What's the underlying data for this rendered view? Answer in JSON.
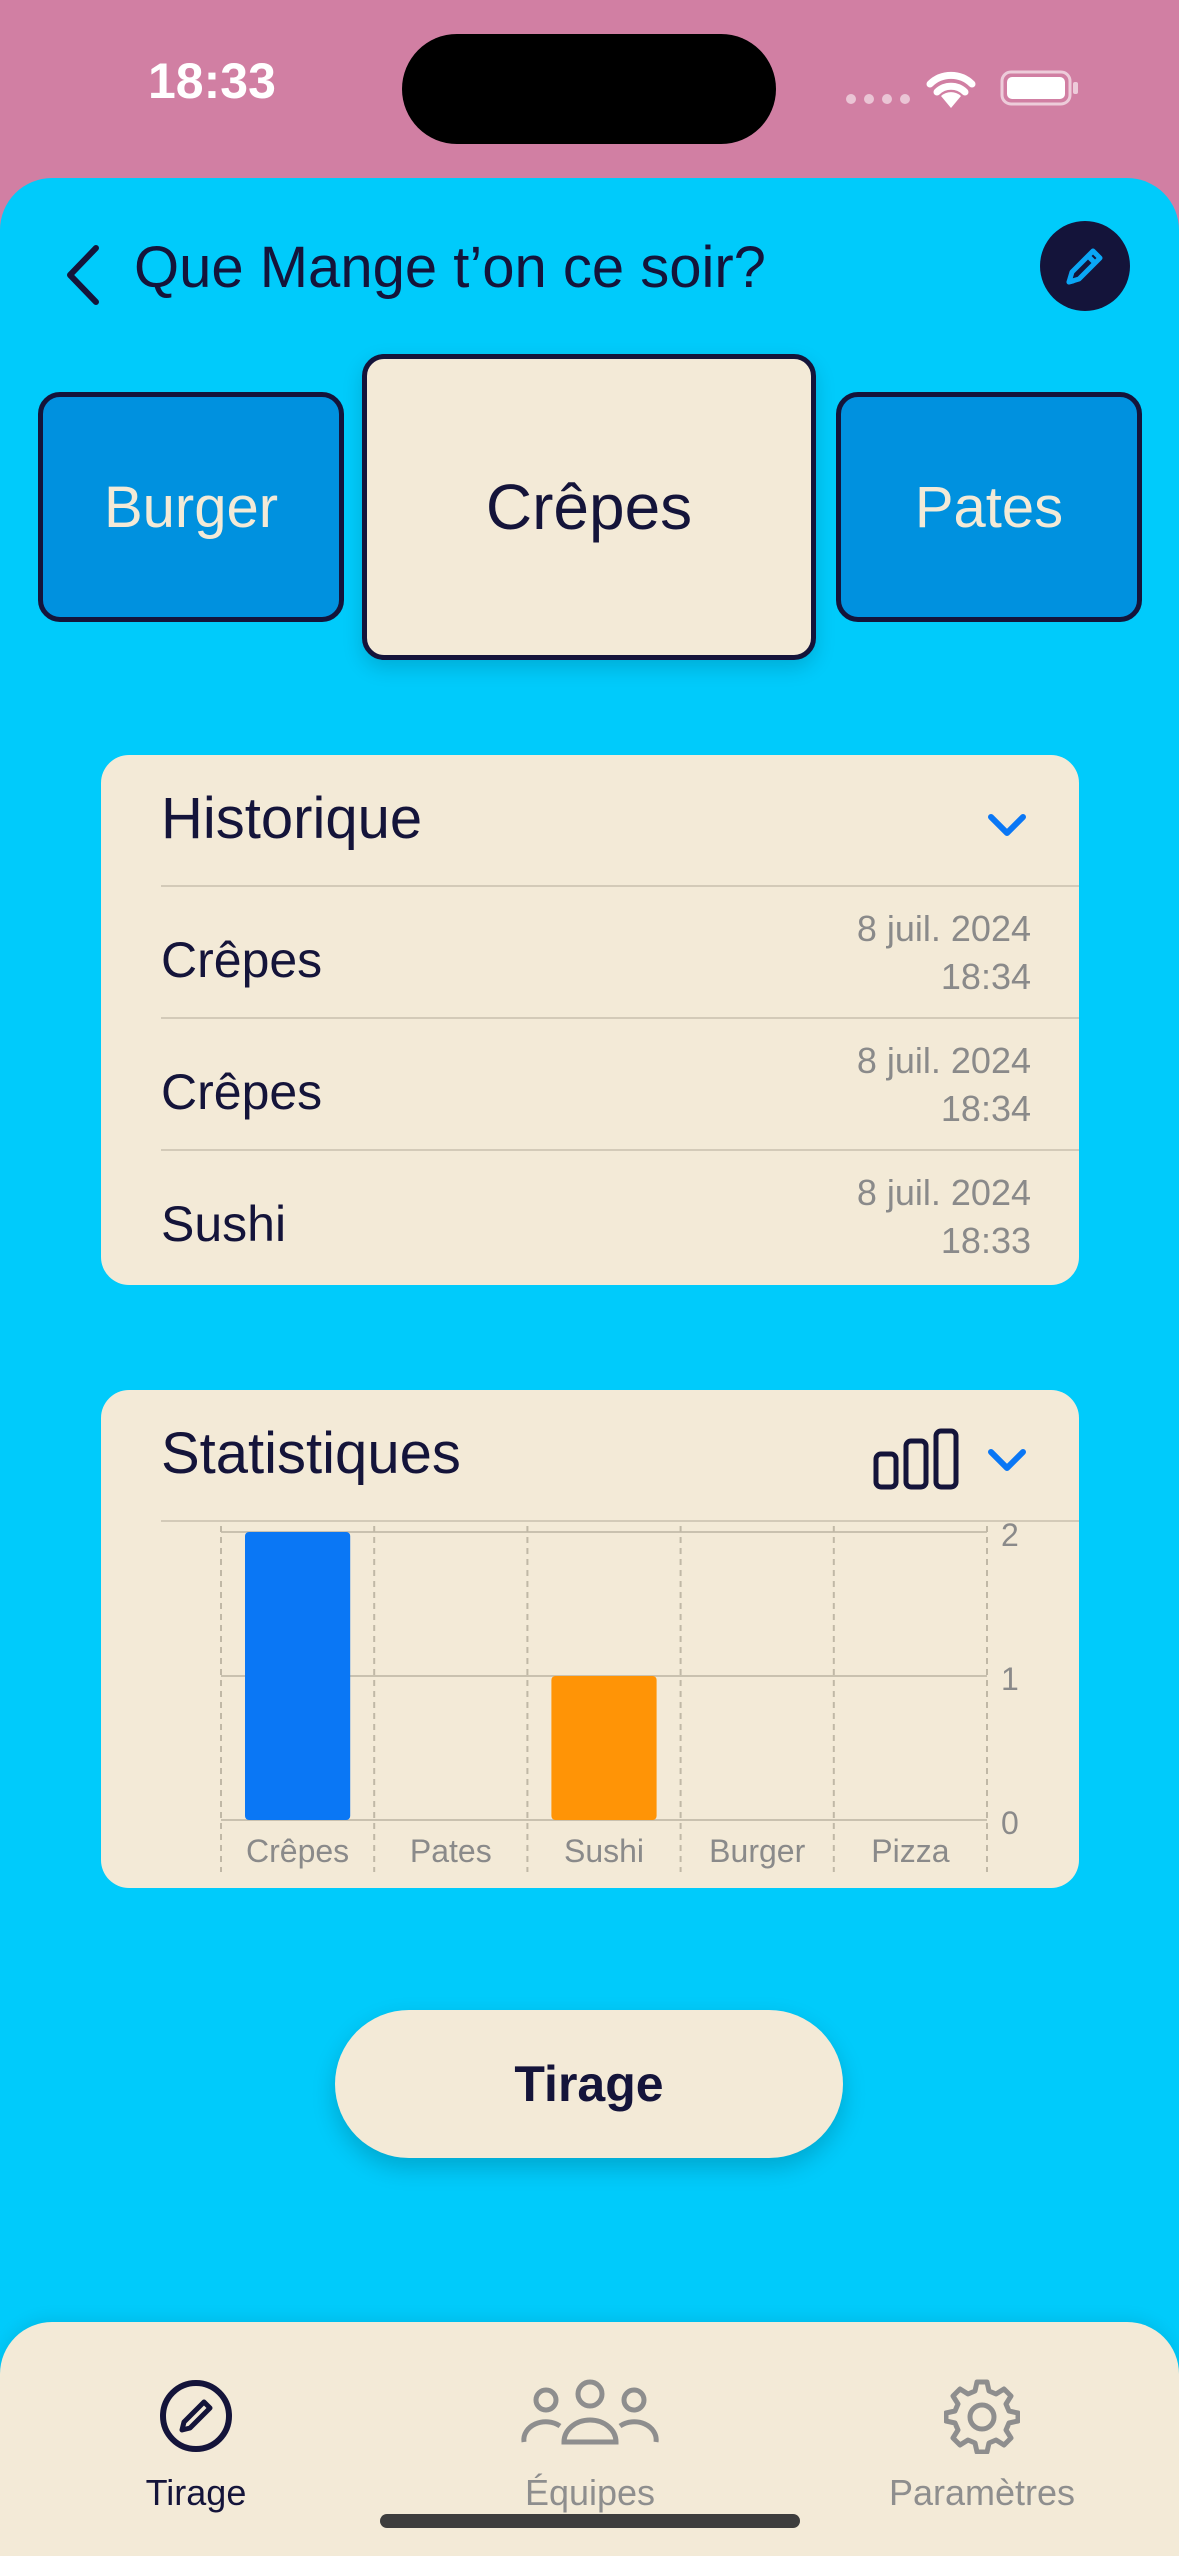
{
  "status_bar": {
    "time": "18:33"
  },
  "header": {
    "title": "Que Mange t’on ce soir?"
  },
  "carousel": {
    "left": "Burger",
    "center": "Crêpes",
    "right": "Pates"
  },
  "history": {
    "title": "Historique",
    "rows": [
      {
        "name": "Crêpes",
        "date": "8 juil. 2024",
        "time": "18:34"
      },
      {
        "name": "Crêpes",
        "date": "8 juil. 2024",
        "time": "18:34"
      },
      {
        "name": "Sushi",
        "date": "8 juil. 2024",
        "time": "18:33"
      }
    ]
  },
  "stats": {
    "title": "Statistiques"
  },
  "chart_data": {
    "type": "bar",
    "categories": [
      "Crêpes",
      "Pates",
      "Sushi",
      "Burger",
      "Pizza"
    ],
    "values": [
      2,
      0,
      1,
      0,
      0
    ],
    "colors": [
      "#0a77f5",
      "#0a77f5",
      "#ff9406",
      "#0a77f5",
      "#0a77f5"
    ],
    "ylim": [
      0,
      2
    ],
    "yticks": [
      "0",
      "1",
      "2"
    ],
    "grid": true
  },
  "draw_button": {
    "label": "Tirage"
  },
  "tabbar": {
    "items": [
      {
        "label": "Tirage",
        "icon": "pencil-circle-icon",
        "active": true
      },
      {
        "label": "Équipes",
        "icon": "people-icon",
        "active": false
      },
      {
        "label": "Paramètres",
        "icon": "gear-icon",
        "active": false
      }
    ]
  },
  "colors": {
    "background": "#00cbfb",
    "status_bar": "#d17fa3",
    "surface": "#f3ead7",
    "ink": "#14143a",
    "card": "#0091df",
    "accent": "#0a77f5",
    "orange": "#ff9406"
  }
}
